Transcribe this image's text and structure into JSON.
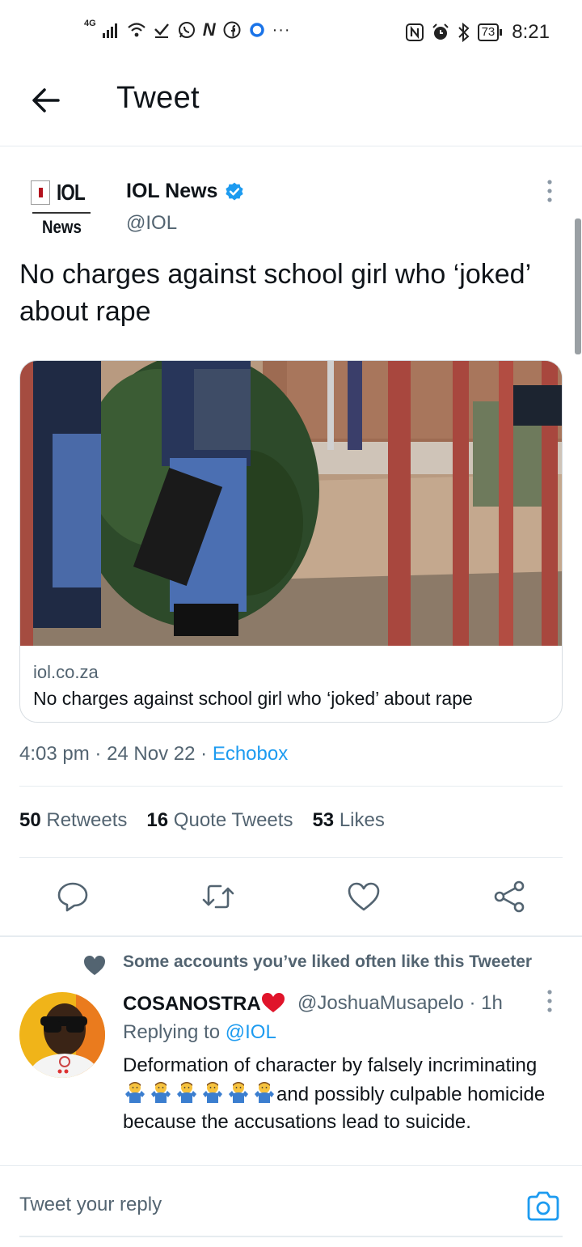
{
  "status_bar": {
    "network": "4G",
    "battery": "73",
    "time": "8:21",
    "left_icons": [
      "signal-icon",
      "wifi-icon",
      "check-icon",
      "whatsapp-icon",
      "n-icon",
      "facebook-icon",
      "circle-icon",
      "more-icon"
    ],
    "right_icons": [
      "nfc-icon",
      "alarm-icon",
      "bluetooth-icon",
      "battery-icon"
    ]
  },
  "header": {
    "title": "Tweet",
    "back_icon": "arrow-left-icon"
  },
  "tweet": {
    "avatar": {
      "logo_text": "IOL",
      "logo_sub": "News"
    },
    "author_name": "IOL News",
    "verified": true,
    "author_handle": "@IOL",
    "text": "No charges against school girl who ‘joked’ about rape",
    "card": {
      "domain": "iol.co.za",
      "title": "No charges against school girl who ‘joked’ about rape"
    },
    "time": "4:03 pm",
    "date": "24 Nov 22",
    "source": "Echobox",
    "stats": {
      "retweets_count": "50",
      "retweets_label": "Retweets",
      "quotes_count": "16",
      "quotes_label": "Quote Tweets",
      "likes_count": "53",
      "likes_label": "Likes"
    },
    "actions": [
      "reply-icon",
      "retweet-icon",
      "like-icon",
      "share-icon"
    ]
  },
  "reply": {
    "social_context": "Some accounts you’ve liked often like this Tweeter",
    "name": "COSANOSTRA",
    "handle": "@JoshuaMusapelo",
    "time": "1h",
    "replying_prefix": "Replying to",
    "replying_to": "@IOL",
    "text_before_emoji": "Deformation of character by falsely incriminating",
    "emoji_count": 6,
    "text_after_emoji": "and possibly culpable homicide because the accusations lead to suicide."
  },
  "compose": {
    "placeholder": "Tweet your reply",
    "camera_icon": "camera-icon"
  },
  "colors": {
    "link": "#1d9bf0",
    "secondary_text": "#536471",
    "divider": "#e6ecf0",
    "heart": "#e0142a"
  }
}
